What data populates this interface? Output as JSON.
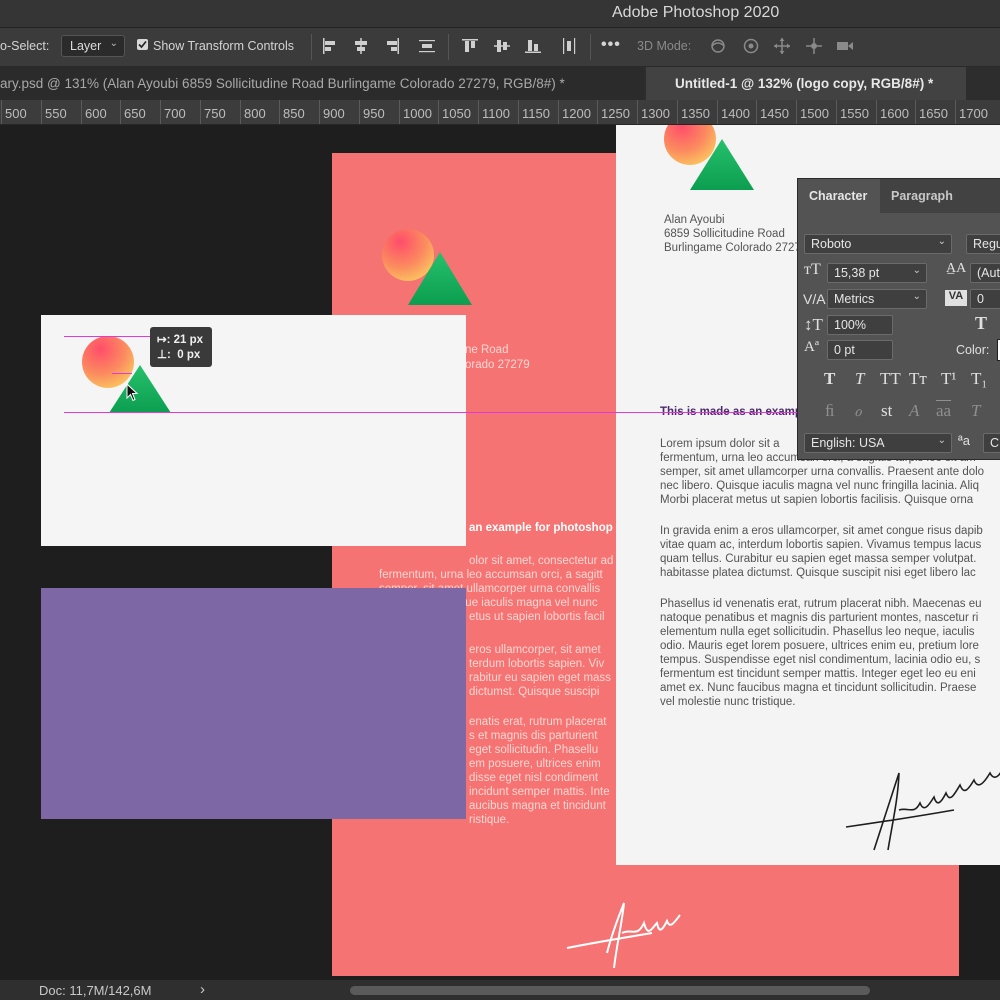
{
  "app": {
    "title": "Adobe Photoshop 2020"
  },
  "options_bar": {
    "auto_select_label": "o-Select:",
    "auto_select_value": "Layer",
    "show_transform_controls": "Show Transform Controls",
    "show_transform_checked": true,
    "more": "•••",
    "mode_3d_label": "3D Mode:"
  },
  "tabs": [
    {
      "label": "ary.psd @ 131% (Alan Ayoubi 6859 Sollicitudine Road Burlingame Colorado 27279, RGB/8#) *",
      "close": "×",
      "active": false
    },
    {
      "label": "Untitled-1 @ 132% (logo copy, RGB/8#) *",
      "close": "×",
      "active": true
    }
  ],
  "ruler": {
    "labels": [
      "500",
      "550",
      "600",
      "650",
      "700",
      "750",
      "800",
      "850",
      "900",
      "950",
      "1000",
      "1050",
      "1100",
      "1150",
      "1200",
      "1250",
      "1300",
      "1350",
      "1400",
      "1450",
      "1500",
      "1550",
      "1600",
      "1650",
      "1700"
    ]
  },
  "measure_tooltip": {
    "line1": "↦: 21 px",
    "line2": "⊥:  0 px"
  },
  "letterhead": {
    "name": "Alan Ayoubi",
    "address1": "6859 Sollicitudine Road",
    "address2": "Burlingame Colorado 27279",
    "heading": "This is made as an example for photoshop",
    "heading_cropped": "This is made as an examp",
    "red_heading_visible": "an example for photoshop",
    "red_addr_part1": "ne Road",
    "red_addr_part2": "orado 27279",
    "white_paragraphs": [
      [
        "Lorem ipsum dolor sit a",
        "fermentum, urna leo accumsan orci, a sagittis turpis leo sit am",
        "semper, sit amet ullamcorper urna convallis. Praesent ante dolo",
        "nec libero. Quisque iaculis magna vel nunc fringilla lacinia. Aliq",
        "Morbi placerat metus ut sapien lobortis facilisis. Quisque orna"
      ],
      [
        "In gravida enim a eros ullamcorper, sit amet congue risus dapib",
        "vitae quam ac, interdum lobortis sapien. Vivamus tempus lacus",
        "quam tellus. Curabitur eu sapien eget massa semper volutpat. ",
        "habitasse platea dictumst. Quisque suscipit nisi eget libero lac"
      ],
      [
        "Phasellus id venenatis erat, rutrum placerat nibh. Maecenas eu",
        "natoque penatibus et magnis dis parturient montes, nascetur ri",
        "elementum nulla eget sollicitudin. Phasellus leo neque, iaculis ",
        "odio. Mauris eget lorem posuere, ultrices enim eu, pretium lore",
        "tempus. Suspendisse eget nisl condimentum, lacinia odio eu, s",
        "fermentum est tincidunt semper mattis. Integer eget leo eu eni",
        "amet ex. Nunc faucibus magna et tincidunt sollicitudin. Praese",
        "vel molestie nunc tristique."
      ]
    ],
    "red_paragraphs": [
      [
        "olor sit amet, consectetur ad",
        "fermentum, urna leo accumsan orci, a sagitt",
        "semper, sit amet ullamcorper urna convallis",
        "nec libero. Quisque iaculis magna vel nunc",
        "etus ut sapien lobortis facil"
      ],
      [
        "eros ullamcorper, sit amet",
        "terdum lobortis sapien. Viv",
        "rabitur eu sapien eget mass",
        "dictumst. Quisque suscipi"
      ],
      [
        "enatis erat, rutrum placerat",
        "s et magnis dis parturient",
        "eget sollicitudin. Phasellu",
        "em posuere, ultrices enim",
        "disse eget nisl condiment",
        "incidunt semper mattis. Inte",
        "aucibus magna et tincidunt",
        "ristique."
      ]
    ]
  },
  "character_panel": {
    "tabs": [
      "Character",
      "Paragraph"
    ],
    "font_family": "Roboto",
    "font_style": "Regu",
    "size": "15,38 pt",
    "leading": "(Auto",
    "kerning": "Metrics",
    "tracking": "0",
    "vertical_scale": "100%",
    "baseline_shift": "0 pt",
    "color_label": "Color:",
    "language": "English: USA",
    "aa_label": "ªa",
    "aa_value": "C",
    "style_buttons": [
      "T",
      "T",
      "TT",
      "Tт",
      "T¹",
      "T₁"
    ],
    "opentype_buttons": [
      "ﬁ",
      "ℴ",
      "st",
      "A",
      "aa",
      "T"
    ]
  },
  "status_bar": {
    "doc": "Doc: 11,7M/142,6M",
    "arrow": "›"
  },
  "colors": {
    "red_paper": "#f57372",
    "purple_card": "#7d67a5",
    "white_paper": "#f4f4f4",
    "guide": "#e03ad8",
    "logo_green": "#1db364",
    "logo_orange": "#f9a35c"
  }
}
